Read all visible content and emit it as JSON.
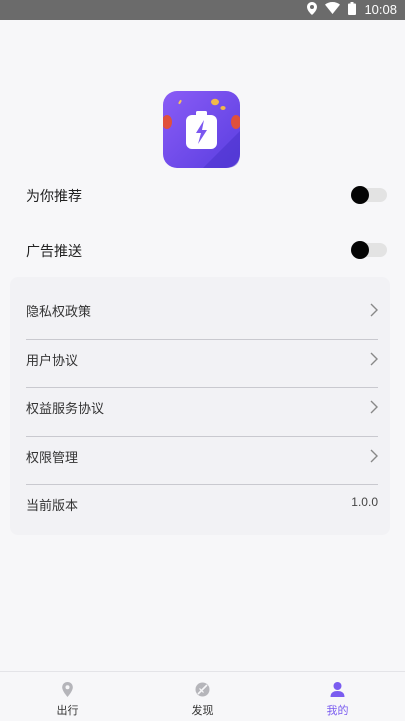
{
  "status_bar": {
    "time": "10:08",
    "icons": [
      "location-icon",
      "wifi-icon",
      "battery-icon"
    ]
  },
  "app_icon": {
    "icon": "battery-charging-icon",
    "colors": {
      "bg_start": "#7b5cf2",
      "bg_end": "#5a3fe0",
      "accent": "#f2c14e"
    }
  },
  "settings": {
    "toggles": [
      {
        "label": "为你推荐",
        "enabled": false
      },
      {
        "label": "广告推送",
        "enabled": false
      }
    ],
    "menu": [
      {
        "label": "隐私权政策",
        "icon": "chevron-right-icon"
      },
      {
        "label": "用户协议",
        "icon": "chevron-right-icon"
      },
      {
        "label": "权益服务协议",
        "icon": "chevron-right-icon"
      },
      {
        "label": "权限管理",
        "icon": "chevron-right-icon"
      }
    ],
    "version": {
      "label": "当前版本",
      "value": "1.0.0"
    }
  },
  "tab_bar": {
    "tabs": [
      {
        "label": "出行",
        "icon": "location-pin-icon",
        "active": false
      },
      {
        "label": "发现",
        "icon": "compass-icon",
        "active": false
      },
      {
        "label": "我的",
        "icon": "user-icon",
        "active": true
      }
    ],
    "active_color": "#7a5cf0"
  }
}
